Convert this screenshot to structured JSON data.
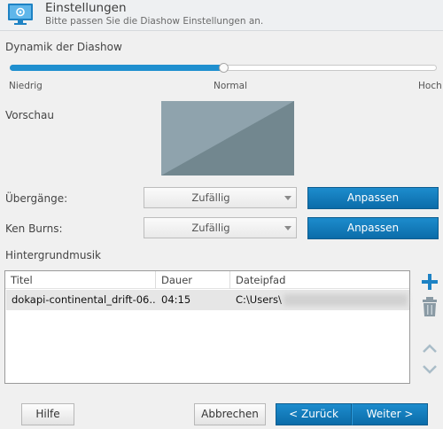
{
  "header": {
    "title": "Einstellungen",
    "subtitle": "Bitte passen Sie die Diashow Einstellungen an."
  },
  "dynamics": {
    "label": "Dynamik der Diashow",
    "value_fraction": 0.5,
    "min_label": "Niedrig",
    "mid_label": "Normal",
    "max_label": "Hoch"
  },
  "preview": {
    "label": "Vorschau"
  },
  "transitions": {
    "label": "Übergänge:",
    "value": "Zufällig",
    "button": "Anpassen"
  },
  "kenburns": {
    "label": "Ken Burns:",
    "value": "Zufällig",
    "button": "Anpassen"
  },
  "music": {
    "label": "Hintergrundmusik",
    "columns": [
      "Titel",
      "Dauer",
      "Dateipfad"
    ],
    "rows": [
      {
        "title": "dokapi-continental_drift-06...",
        "duration": "04:15",
        "path": "C:\\Users\\"
      }
    ]
  },
  "footer": {
    "help": "Hilfe",
    "cancel": "Abbrechen",
    "back": "< Zurück",
    "next": "Weiter >"
  },
  "colors": {
    "accent": "#1f8fcf",
    "button_blue": "#0b6ca9"
  },
  "icons": {
    "app": "monitor-settings-icon",
    "add": "plus-icon",
    "delete": "trash-icon",
    "up": "chevron-up-icon",
    "down": "chevron-down-icon"
  }
}
